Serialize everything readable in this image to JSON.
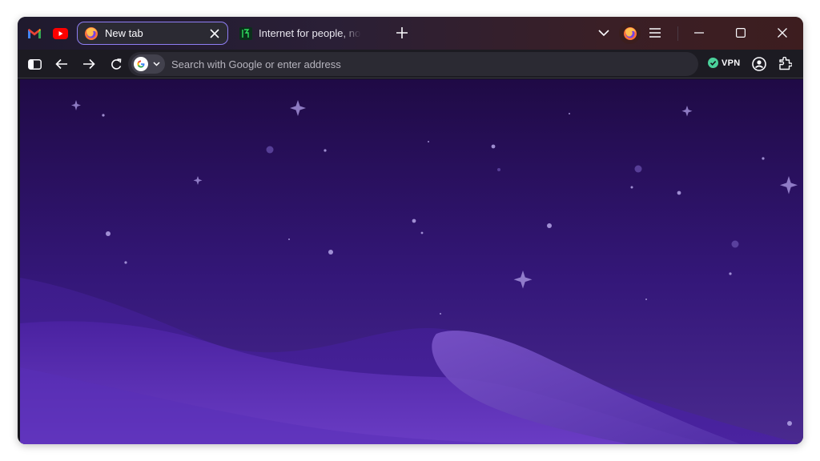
{
  "pinned_tabs": [
    {
      "name": "Gmail",
      "icon": "gmail-icon"
    },
    {
      "name": "YouTube",
      "icon": "youtube-icon"
    }
  ],
  "tabs": [
    {
      "title": "New tab",
      "icon": "firefox-icon",
      "active": true
    },
    {
      "title": "Internet for people, no",
      "icon": "mozilla-icon",
      "active": false
    }
  ],
  "toolbar": {
    "search_placeholder": "Search with Google or enter address",
    "search_engine_icon": "google-icon",
    "vpn_label": "VPN"
  },
  "colors": {
    "accent": "#8f7ef5",
    "vpn_status": "#4bd19b",
    "sky_top": "#1f0a45",
    "sky_bottom": "#5633a8"
  }
}
